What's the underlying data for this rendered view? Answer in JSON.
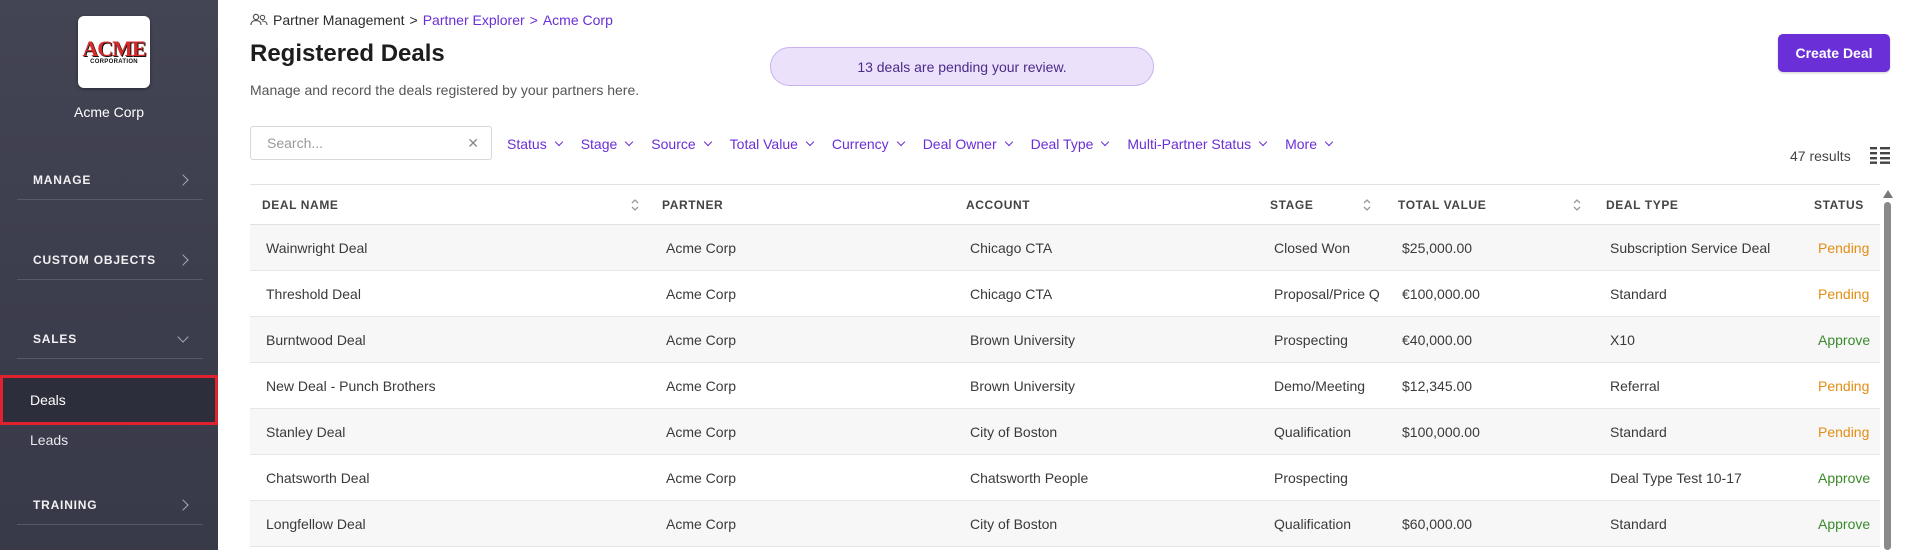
{
  "sidebar": {
    "logo_text": "ACME",
    "logo_subtext": "CORPORATION",
    "org_name": "Acme Corp",
    "sections": [
      {
        "label": "MANAGE"
      },
      {
        "label": "CUSTOM OBJECTS"
      },
      {
        "label": "SALES"
      },
      {
        "label": "TRAINING"
      }
    ],
    "items": [
      {
        "label": "Deals"
      },
      {
        "label": "Leads"
      }
    ]
  },
  "breadcrumb": {
    "root": "Partner Management",
    "sep1": ">",
    "level2": "Partner Explorer",
    "sep2": ">",
    "level3": "Acme Corp"
  },
  "header": {
    "title": "Registered Deals",
    "subtitle": "Manage and record the deals registered by your partners here.",
    "pending_banner": "13 deals are pending your review.",
    "create_label": "Create Deal"
  },
  "search": {
    "placeholder": "Search...",
    "clear": "✕"
  },
  "filters": [
    "Status",
    "Stage",
    "Source",
    "Total Value",
    "Currency",
    "Deal Owner",
    "Deal Type",
    "Multi-Partner Status",
    "More"
  ],
  "results_text": "47 results",
  "table": {
    "columns": [
      "DEAL NAME",
      "PARTNER",
      "ACCOUNT",
      "STAGE",
      "TOTAL VALUE",
      "DEAL TYPE",
      "STATUS"
    ],
    "rows": [
      {
        "name": "Wainwright Deal",
        "partner": "Acme Corp",
        "account": "Chicago CTA",
        "stage": "Closed Won",
        "value": "$25,000.00",
        "type": "Subscription Service Deal",
        "status": "Pending"
      },
      {
        "name": "Threshold Deal",
        "partner": "Acme Corp",
        "account": "Chicago CTA",
        "stage": "Proposal/Price Q",
        "value": "€100,000.00",
        "type": "Standard",
        "status": "Pending"
      },
      {
        "name": "Burntwood Deal",
        "partner": "Acme Corp",
        "account": "Brown University",
        "stage": "Prospecting",
        "value": "€40,000.00",
        "type": "X10",
        "status": "Approve"
      },
      {
        "name": "New Deal - Punch Brothers",
        "partner": "Acme Corp",
        "account": "Brown University",
        "stage": "Demo/Meeting",
        "value": "$12,345.00",
        "type": "Referral",
        "status": "Pending"
      },
      {
        "name": "Stanley Deal",
        "partner": "Acme Corp",
        "account": "City of Boston",
        "stage": "Qualification",
        "value": "$100,000.00",
        "type": "Standard",
        "status": "Pending"
      },
      {
        "name": "Chatsworth Deal",
        "partner": "Acme Corp",
        "account": "Chatsworth People",
        "stage": "Prospecting",
        "value": "",
        "type": "Deal Type Test 10-17",
        "status": "Approve"
      },
      {
        "name": "Longfellow Deal",
        "partner": "Acme Corp",
        "account": "City of Boston",
        "stage": "Qualification",
        "value": "$60,000.00",
        "type": "Standard",
        "status": "Approve"
      }
    ]
  },
  "colors": {
    "accent": "#6a2fd6",
    "pending": "#e38d13",
    "approved": "#3a8a2a",
    "sidebar_bg": "#3f4050",
    "active_outline": "#e0212e"
  }
}
